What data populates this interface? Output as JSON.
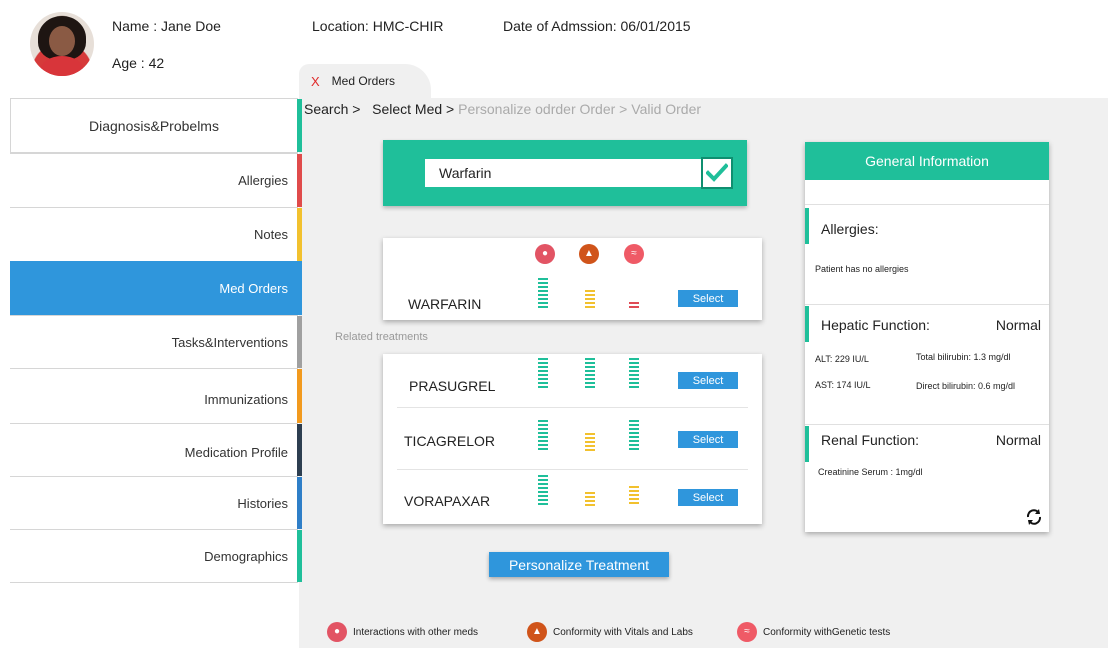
{
  "patient": {
    "name": "Name : Jane Doe",
    "age": "Age : 42",
    "location": "Location: HMC-CHIR",
    "admission": "Date of Admssion: 06/01/2015"
  },
  "tab": {
    "close": "X",
    "label": "Med Orders"
  },
  "breadcrumb": {
    "search": "Search >",
    "select": "Select Med >",
    "personalize": "Personalize odrder Order >",
    "valid": "Valid Order"
  },
  "sidebar": {
    "items": [
      {
        "label": "Diagnosis&Probelms",
        "color": "#1fbf9a"
      },
      {
        "label": "Allergies",
        "color": "#e04b4b"
      },
      {
        "label": "Notes",
        "color": "#f2c12e"
      },
      {
        "label": "Med Orders",
        "color": "#1fbf9a",
        "active": true
      },
      {
        "label": "Tasks&Interventions",
        "color": "#a0a0a0"
      },
      {
        "label": "Immunizations",
        "color": "#f29a1e"
      },
      {
        "label": "Medication Profile",
        "color": "#2d3e50"
      },
      {
        "label": "Histories",
        "color": "#2f7fc8"
      },
      {
        "label": "Demographics",
        "color": "#1fbf9a"
      }
    ]
  },
  "search": {
    "value": "Warfarin"
  },
  "selected_med": {
    "name": "WARFARIN",
    "select": "Select"
  },
  "related_label": "Related treatments",
  "related": [
    {
      "name": "PRASUGREL",
      "select": "Select"
    },
    {
      "name": "TICAGRELOR",
      "select": "Select"
    },
    {
      "name": "VORAPAXAR",
      "select": "Select"
    }
  ],
  "personalize_button": "Personalize Treatment",
  "general_info": {
    "title": "General Information",
    "allergies_title": "Allergies:",
    "allergies_text": "Patient has no allergies",
    "hepatic_title": "Hepatic Function:",
    "hepatic_status": "Normal",
    "alt": "ALT: 229 IU/L",
    "ast": "AST: 174 IU/L",
    "total_bili": "Total bilirubin: 1.3 mg/dl",
    "direct_bili": "Direct bilirubin: 0.6 mg/dl",
    "renal_title": "Renal Function:",
    "renal_status": "Normal",
    "creatinine": "Creatinine Serum : 1mg/dl"
  },
  "legend": {
    "interactions": "Interactions with other meds",
    "vitals": "Conformity with Vitals and Labs",
    "genetic": "Conformity withGenetic tests"
  },
  "icons": {
    "interactions": "pill-icon",
    "vitals": "flask-icon",
    "genetic": "dna-icon",
    "refresh": "refresh-icon",
    "confirm": "check-icon"
  },
  "colors": {
    "accent": "#1fbf9a",
    "primary": "#2f96dc",
    "good": "#1fbf9a",
    "warn": "#f2c12e",
    "bad": "#e04b55"
  }
}
